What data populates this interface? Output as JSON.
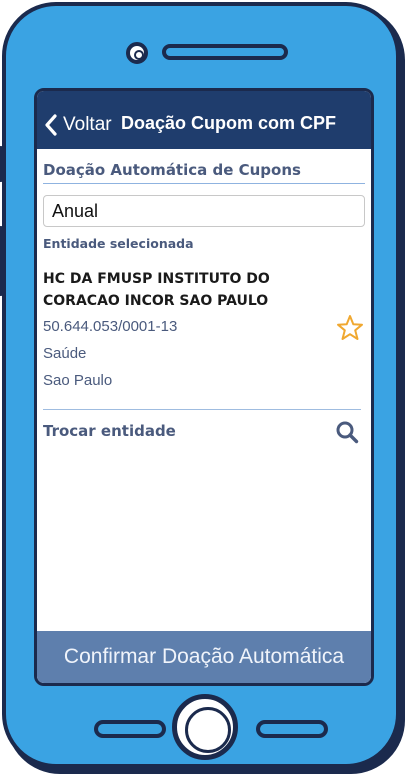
{
  "navbar": {
    "back_label": "Voltar",
    "title": "Doação Cupom com CPF"
  },
  "content": {
    "section_title": "Doação Automática de Cupons",
    "frequency_value": "Anual",
    "selected_label": "Entidade selecionada",
    "entity": {
      "name": "HC DA FMUSP INSTITUTO DO CORACAO INCOR SAO PAULO",
      "cnpj": "50.644.053/0001-13",
      "category": "Saúde",
      "city": "Sao Paulo"
    },
    "change_entity_label": "Trocar entidade"
  },
  "footer": {
    "confirm_label": "Confirmar Doação Automática"
  },
  "icons": {
    "back": "chevron-left-icon",
    "favorite": "star-outline-icon",
    "search": "magnifier-icon"
  },
  "colors": {
    "phone_body": "#3aa3e3",
    "phone_outline": "#1b2a4d",
    "navbar": "#1f3d6d",
    "accent_text": "#4a5a7d",
    "star": "#f0a830",
    "confirm_button": "#5e7fad"
  }
}
